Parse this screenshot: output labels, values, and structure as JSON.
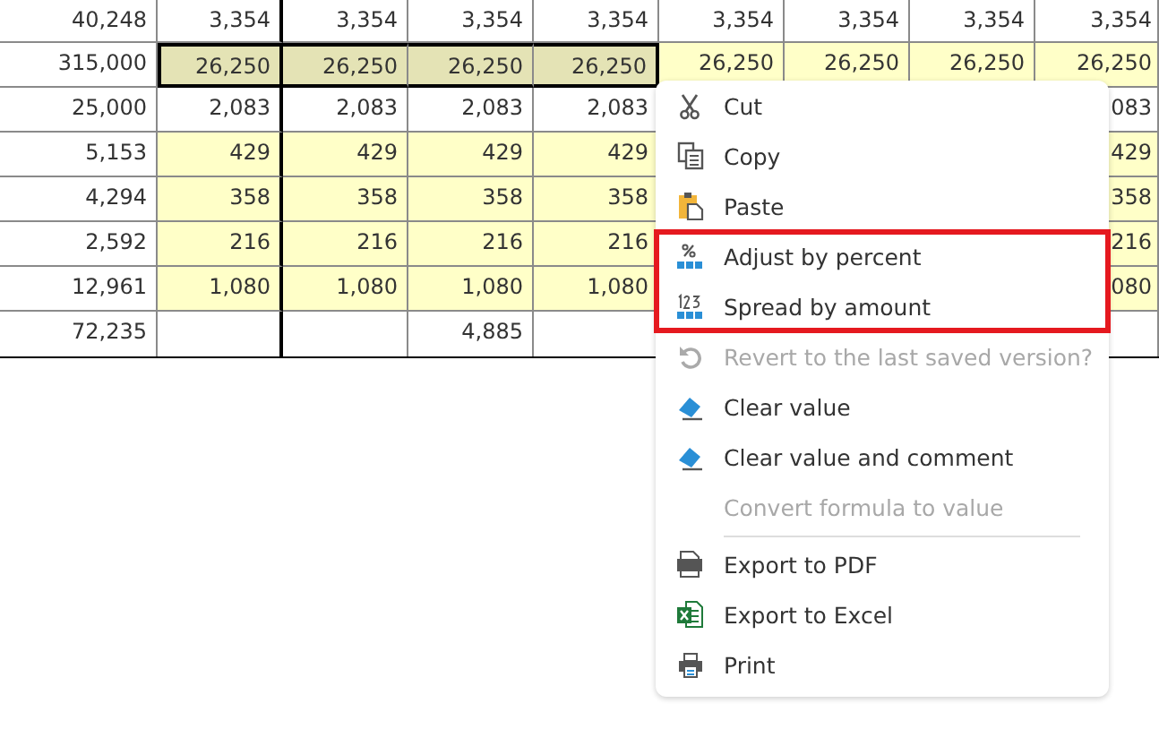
{
  "grid": {
    "rows": [
      {
        "cells": [
          {
            "text": "40,248",
            "kind": "plain",
            "selected": false
          },
          {
            "text": "3,354",
            "kind": "plain",
            "selected": false
          },
          {
            "text": "3,354",
            "kind": "plain",
            "selected": false
          },
          {
            "text": "3,354",
            "kind": "plain",
            "selected": false
          },
          {
            "text": "3,354",
            "kind": "plain",
            "selected": false
          },
          {
            "text": "3,354",
            "kind": "plain",
            "selected": false
          },
          {
            "text": "3,354",
            "kind": "plain",
            "selected": false
          },
          {
            "text": "3,354",
            "kind": "plain",
            "selected": false
          },
          {
            "text": "3,354",
            "kind": "plain",
            "selected": false
          }
        ]
      },
      {
        "cells": [
          {
            "text": "315,000",
            "kind": "plain",
            "selected": false
          },
          {
            "text": "26,250",
            "kind": "input",
            "selected": true
          },
          {
            "text": "26,250",
            "kind": "input",
            "selected": true
          },
          {
            "text": "26,250",
            "kind": "input",
            "selected": true
          },
          {
            "text": "26,250",
            "kind": "input",
            "selected": true
          },
          {
            "text": "26,250",
            "kind": "input",
            "selected": false
          },
          {
            "text": "26,250",
            "kind": "input",
            "selected": false
          },
          {
            "text": "26,250",
            "kind": "input",
            "selected": false
          },
          {
            "text": "26,250",
            "kind": "input",
            "selected": false
          }
        ]
      },
      {
        "cells": [
          {
            "text": "25,000",
            "kind": "plain",
            "selected": false
          },
          {
            "text": "2,083",
            "kind": "plain",
            "selected": false
          },
          {
            "text": "2,083",
            "kind": "plain",
            "selected": false
          },
          {
            "text": "2,083",
            "kind": "plain",
            "selected": false
          },
          {
            "text": "2,083",
            "kind": "plain",
            "selected": false
          },
          null,
          null,
          null,
          {
            "text": "083",
            "kind": "plain",
            "selected": false
          }
        ]
      },
      {
        "cells": [
          {
            "text": "5,153",
            "kind": "plain",
            "selected": false
          },
          {
            "text": "429",
            "kind": "input",
            "selected": false
          },
          {
            "text": "429",
            "kind": "input",
            "selected": false
          },
          {
            "text": "429",
            "kind": "input",
            "selected": false
          },
          {
            "text": "429",
            "kind": "input",
            "selected": false
          },
          null,
          null,
          null,
          {
            "text": "429",
            "kind": "input",
            "selected": false
          }
        ]
      },
      {
        "cells": [
          {
            "text": "4,294",
            "kind": "plain",
            "selected": false
          },
          {
            "text": "358",
            "kind": "input",
            "selected": false
          },
          {
            "text": "358",
            "kind": "input",
            "selected": false
          },
          {
            "text": "358",
            "kind": "input",
            "selected": false
          },
          {
            "text": "358",
            "kind": "input",
            "selected": false
          },
          null,
          null,
          null,
          {
            "text": "358",
            "kind": "input",
            "selected": false
          }
        ]
      },
      {
        "cells": [
          {
            "text": "2,592",
            "kind": "plain",
            "selected": false
          },
          {
            "text": "216",
            "kind": "input",
            "selected": false
          },
          {
            "text": "216",
            "kind": "input",
            "selected": false
          },
          {
            "text": "216",
            "kind": "input",
            "selected": false
          },
          {
            "text": "216",
            "kind": "input",
            "selected": false
          },
          null,
          null,
          null,
          {
            "text": "216",
            "kind": "input",
            "selected": false
          }
        ]
      },
      {
        "cells": [
          {
            "text": "12,961",
            "kind": "plain",
            "selected": false
          },
          {
            "text": "1,080",
            "kind": "input",
            "selected": false
          },
          {
            "text": "1,080",
            "kind": "input",
            "selected": false
          },
          {
            "text": "1,080",
            "kind": "input",
            "selected": false
          },
          {
            "text": "1,080",
            "kind": "input",
            "selected": false
          },
          null,
          null,
          null,
          {
            "text": "080",
            "kind": "input",
            "selected": false
          }
        ]
      },
      {
        "cells": [
          {
            "text": "72,235",
            "kind": "plain",
            "selected": false
          },
          null,
          null,
          {
            "text": "4,885",
            "kind": "plain",
            "selected": false
          },
          null,
          null,
          null,
          null,
          null
        ]
      }
    ]
  },
  "context_menu": {
    "groups": [
      {
        "framed": false,
        "divider": false,
        "items": [
          {
            "label": "Cut",
            "kind": "scissors",
            "disabled": false
          },
          {
            "label": "Copy",
            "kind": "copy",
            "disabled": false
          },
          {
            "label": "Paste",
            "kind": "paste",
            "disabled": false
          }
        ]
      },
      {
        "framed": true,
        "divider": false,
        "items": [
          {
            "label": "Adjust by percent",
            "kind": "percent",
            "disabled": false
          },
          {
            "label": "Spread by amount",
            "kind": "numbers",
            "disabled": false
          }
        ]
      },
      {
        "framed": false,
        "divider": false,
        "items": [
          {
            "label": "Revert to the last saved version?",
            "kind": "undo",
            "disabled": true
          },
          {
            "label": "Clear value",
            "kind": "eraser",
            "disabled": false
          },
          {
            "label": "Clear value and comment",
            "kind": "eraser",
            "disabled": false
          },
          {
            "label": "Convert formula to value",
            "kind": "plain",
            "disabled": true
          }
        ]
      },
      {
        "framed": false,
        "divider": true,
        "items": [
          {
            "label": "Export to PDF",
            "kind": "pdf",
            "disabled": false
          },
          {
            "label": "Export to Excel",
            "kind": "excel",
            "disabled": false
          },
          {
            "label": "Print",
            "kind": "printer",
            "disabled": false
          }
        ]
      }
    ]
  }
}
